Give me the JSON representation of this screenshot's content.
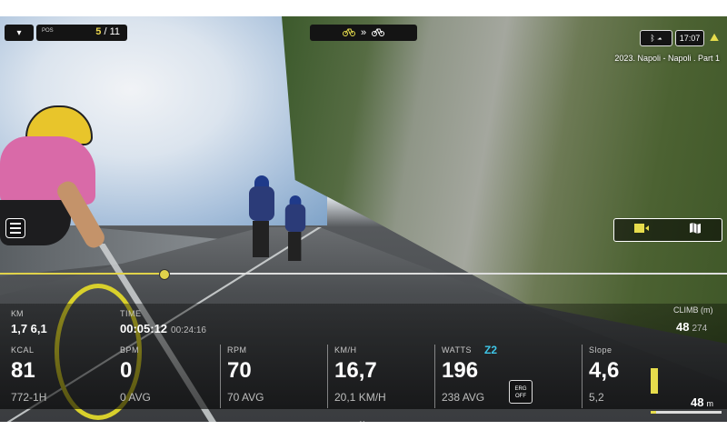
{
  "hud": {
    "position_label": "POS",
    "position_current": "5",
    "position_total": "/ 11",
    "clock": "17:07",
    "route_title": "2023. Napoli - Napoli . Part 1"
  },
  "stats": {
    "km": {
      "label": "KM",
      "value": "1,7 6,1"
    },
    "time": {
      "label": "TIME",
      "value": "00:05:12",
      "total": "00:24:16"
    },
    "kcal": {
      "label": "KCAL",
      "value": "81",
      "sub": "772-1H"
    },
    "bpm": {
      "label": "BPM",
      "value": "0",
      "sub": "0 AVG"
    },
    "rpm": {
      "label": "RPM",
      "value": "70",
      "sub": "70 AVG"
    },
    "speed": {
      "label": "KM/H",
      "value": "16,7",
      "sub": "20,1 KM/H"
    },
    "watts": {
      "label": "WATTS",
      "zone": "Z2",
      "value": "196",
      "sub": "238 AVG",
      "erg_line1": "ERG",
      "erg_line2": "OFF"
    },
    "slope": {
      "label": "Slope",
      "value": "4,6",
      "sub": "5,2"
    },
    "climb": {
      "label": "CLIMB (m)",
      "value": "48",
      "total": "274"
    },
    "distance": {
      "value": "48",
      "unit": "m",
      "progress": 0.08
    }
  },
  "icons": [
    "chevron-down-icon",
    "bike-icon",
    "sync-icon",
    "bluetooth-icon",
    "cloud-icon",
    "climb-icon",
    "menu-icon",
    "camera-icon",
    "map-icon"
  ],
  "colors": {
    "accent": "#e6dc4c",
    "zone": "#3ec6e8"
  }
}
